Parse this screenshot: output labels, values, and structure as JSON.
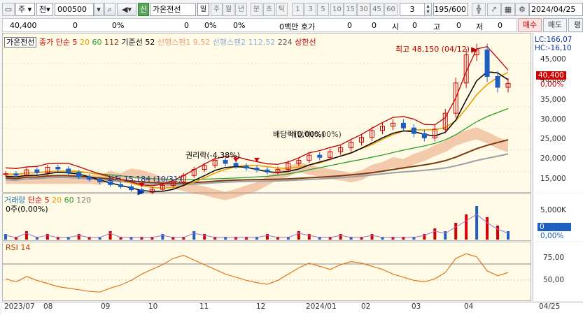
{
  "toolbar": {
    "mode": "주",
    "prev": "전",
    "code": "000500",
    "sin": "신",
    "name": "가온전선",
    "periods": [
      "일",
      "주",
      "월",
      "년",
      "분",
      "초",
      "틱"
    ],
    "nums": [
      "1",
      "3",
      "5",
      "10",
      "15",
      "30",
      "45",
      "60"
    ],
    "sel": "3",
    "count": "195/600",
    "date": "2024/04/25"
  },
  "quote": {
    "price": "40,400",
    "v1": "0",
    "v2": "0%",
    "v3": "0",
    "v4": "0%",
    "v5": "0%",
    "v6": "0백만",
    "hoga": "호가",
    "v7": "0",
    "si_l": "시",
    "si": "0",
    "go_l": "고",
    "go": "0",
    "jeo_l": "저",
    "jeo": "0",
    "buy": "매수",
    "sell": "매도",
    "extra": "평"
  },
  "legend": {
    "name": "가온전선",
    "ma_label": "종가 단순",
    "ma": [
      "5",
      "20",
      "60",
      "112"
    ],
    "kijun": "기준선 52",
    "span1": "선행스팬1 9,52",
    "span2": "선행스팬2 112,52",
    "num224": "224",
    "upper": "상한선"
  },
  "annotations": {
    "high": "최고 48,150 (04/12)",
    "low": "최저 15,184 (10/31)",
    "gwon": "권리락(-4,38%)",
    "baedang": "배당락(0,00%)",
    "baedang2": "배당락(0,00%)"
  },
  "price_axis": {
    "lc": "LC:166,07",
    "hc": "HC:-16,10",
    "cur": "40,400",
    "pct": "0,00%",
    "ticks": [
      "45,000",
      "40,000",
      "35,000",
      "30,000",
      "25,000",
      "20,000",
      "15,000"
    ]
  },
  "volume": {
    "title": "거래량",
    "ma_label": "단순",
    "ma": [
      "5",
      "20",
      "60",
      "120"
    ],
    "info": "0주(0,00%)",
    "ticks": [
      "5,000K",
      "0",
      "0,00%"
    ]
  },
  "rsi": {
    "title": "RSI 14",
    "ticks": [
      "75,00",
      "50,00"
    ]
  },
  "xaxis": [
    "2023/07",
    "08",
    "09",
    "10",
    "11",
    "12",
    "2024/01",
    "02",
    "03",
    "04",
    "04/25"
  ],
  "colors": {
    "ma5": "#d40000",
    "ma20": "#e8a000",
    "ma60": "#2a9d2a",
    "ma112": "#7a3b12",
    "kijun": "#000000",
    "span1": "#e9a27a",
    "span2": "#a9c4ea",
    "upper": "#c00000",
    "rsi": "#e07820"
  },
  "chart_data": {
    "type": "line",
    "series": [
      {
        "name": "가온전선",
        "values": [
          19500,
          19200,
          20400,
          19800,
          21000,
          20600,
          19800,
          18800,
          18200,
          17600,
          17000,
          16500,
          15800,
          15200,
          15900,
          16800,
          17600,
          19100,
          20500,
          21400,
          22600,
          21900,
          21300,
          20800,
          20400,
          19900,
          20500,
          21900,
          22600,
          23800,
          23300,
          24600,
          25500,
          26800,
          27900,
          29500,
          30500,
          31200,
          30100,
          28800,
          27800,
          29800,
          33500,
          40500,
          47000,
          48150,
          42000,
          39500,
          40400
        ]
      }
    ],
    "ylim": [
      13000,
      50000
    ]
  }
}
